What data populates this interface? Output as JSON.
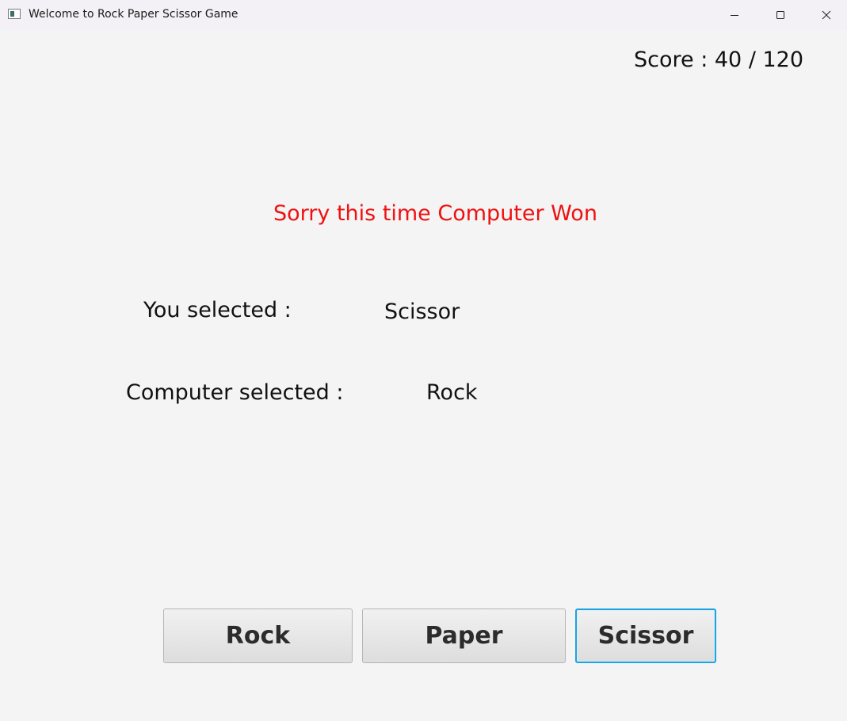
{
  "window": {
    "title": "Welcome to Rock Paper Scissor Game",
    "controls": {
      "minimize_icon": "minimize-icon",
      "maximize_icon": "maximize-icon",
      "close_icon": "close-icon"
    }
  },
  "score": {
    "text": "Score : 40 / 120"
  },
  "result": {
    "message": "Sorry this time Computer Won",
    "color": "#ee1111"
  },
  "selection": {
    "you_label": "You selected :",
    "you_value": "Scissor",
    "computer_label": "Computer selected :",
    "computer_value": "Rock"
  },
  "buttons": {
    "rock": "Rock",
    "paper": "Paper",
    "scissor": "Scissor",
    "focus_color": "#1da3e0"
  }
}
